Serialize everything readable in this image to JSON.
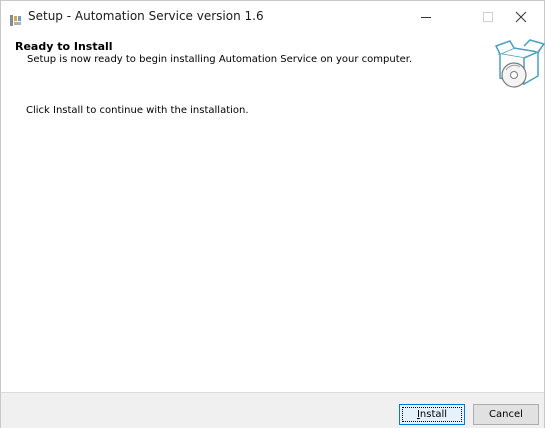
{
  "window": {
    "title": "Setup - Automation Service version 1.6"
  },
  "header": {
    "title": "Ready to Install",
    "subtitle": "Setup is now ready to begin installing Automation Service on your computer."
  },
  "body": {
    "instruction": "Click Install to continue with the installation."
  },
  "buttons": {
    "install_first": "I",
    "install_rest": "nstall",
    "cancel": "Cancel"
  },
  "icons": {
    "app": "setup-app-icon",
    "wizard": "box-with-disc-icon",
    "minimize": "minimize-icon",
    "maximize": "maximize-icon",
    "close": "close-icon"
  },
  "colors": {
    "accent": "#0078d7",
    "footer_bg": "#f0f0f0"
  }
}
